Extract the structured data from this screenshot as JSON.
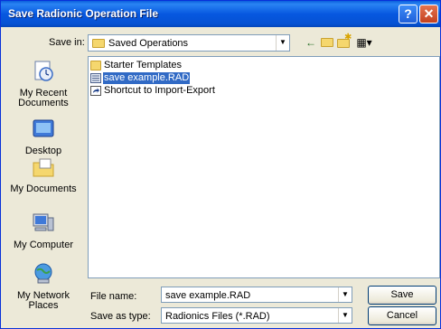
{
  "window": {
    "title": "Save Radionic Operation File",
    "help_glyph": "?",
    "close_glyph": "✕"
  },
  "save_in": {
    "label": "Save in:",
    "value": "Saved Operations"
  },
  "toolbar": {
    "back_glyph": "←",
    "up_glyph": "⬑",
    "new_folder_glyph": "✱",
    "views_glyph": "▦▾"
  },
  "places": [
    {
      "label": "My Recent Documents",
      "icon": "recent-documents-icon"
    },
    {
      "label": "Desktop",
      "icon": "desktop-icon"
    },
    {
      "label": "My Documents",
      "icon": "my-documents-icon"
    },
    {
      "label": "My Computer",
      "icon": "my-computer-icon"
    },
    {
      "label": "My Network Places",
      "icon": "network-places-icon"
    }
  ],
  "files": [
    {
      "name": "Starter Templates",
      "type": "folder"
    },
    {
      "name": "save example.RAD",
      "type": "file",
      "selected": true
    },
    {
      "name": "Shortcut to Import-Export",
      "type": "shortcut"
    }
  ],
  "file_name": {
    "label": "File name:",
    "value": "save example.RAD"
  },
  "save_as_type": {
    "label": "Save as type:",
    "value": "Radionics Files (*.RAD)"
  },
  "buttons": {
    "save": "Save",
    "cancel": "Cancel"
  },
  "colors": {
    "title_blue": "#0758e0",
    "selection": "#316ac5",
    "dialog_bg": "#ece9d8"
  }
}
